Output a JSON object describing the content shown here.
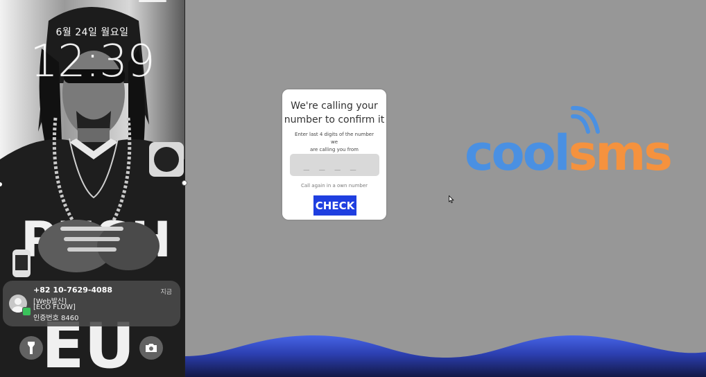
{
  "lock_screen": {
    "date": "6월 24일 월요일",
    "time": "12:39",
    "notification": {
      "sender": "+82 10-7629-4088",
      "time": "지금",
      "lines": [
        "[Web발신]",
        "[ECO FLOW]",
        "인증번호 8460"
      ]
    },
    "flashlight_icon": "flashlight-icon",
    "camera_icon": "camera-icon"
  },
  "verify_card": {
    "title_line1": "We're calling your",
    "title_line2": "number to confirm it",
    "subtitle_line1": "Enter last 4 digits of the number we",
    "subtitle_line2": "are calling you from",
    "code_placeholder": "____",
    "call_again_link": "Call again in a own number",
    "check_button": "CHECK"
  },
  "logo": {
    "part1": "cool",
    "part2": "sms",
    "color1": "#4a90e2",
    "color2": "#f5923e"
  },
  "colors": {
    "background": "#979797",
    "button": "#1f3fe0",
    "wave_top": "#3f59d8",
    "wave_bottom": "#141a55"
  }
}
